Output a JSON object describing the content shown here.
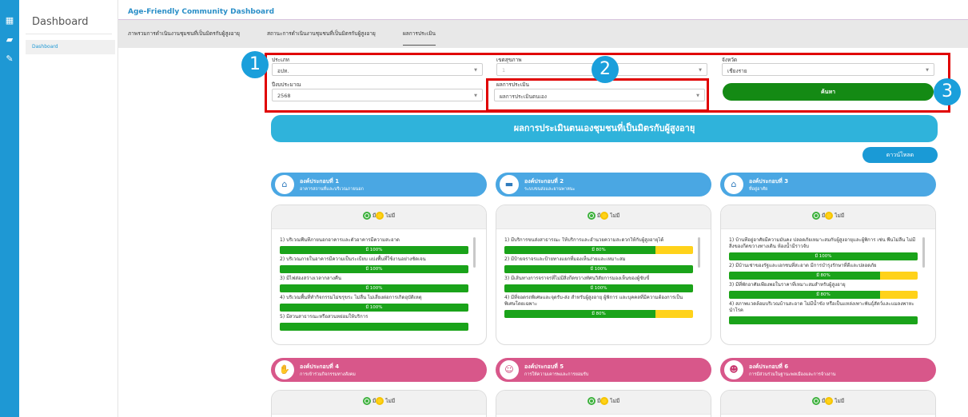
{
  "rail": {
    "icons": [
      "dashboard-icon",
      "folder-icon",
      "edit-icon"
    ]
  },
  "sidebar": {
    "title": "Dashboard",
    "items": [
      {
        "label": "Dashboard"
      }
    ]
  },
  "header": {
    "app_title": "Age-Friendly Community Dashboard",
    "tabs": [
      {
        "label": "ภาพรวมการดำเนินงานชุมชนที่เป็นมิตรกับผู้สูงอายุ"
      },
      {
        "label": "สถานะการดำเนินงานชุมชนที่เป็นมิตรกับผู้สูงอายุ"
      },
      {
        "label": "ผลการประเมิน"
      }
    ],
    "active_tab": "ผลการประเมิน"
  },
  "filters": {
    "type": {
      "label": "ประเภท",
      "value": "อปท."
    },
    "health_zone": {
      "label": "เขตสุขภาพ",
      "value": "1"
    },
    "province": {
      "label": "จังหวัด",
      "value": "เชียงราย"
    },
    "fiscal_year": {
      "label": "ปีงบประมาณ",
      "value": "2568"
    },
    "result": {
      "label": "ผลการประเมิน",
      "value": "ผลการประเมินตนเอง"
    },
    "search_label": "ค้นหา"
  },
  "callouts": [
    "1",
    "2",
    "3"
  ],
  "banner": {
    "title": "ผลการประเมินตนเองชุมชนที่เป็นมิตรกับผู้สูงอายุ"
  },
  "download_label": "ดาวน์โหลด",
  "legend": {
    "yes": "มี",
    "no": "ไม่มี"
  },
  "colors": {
    "yes": "#1aa31a",
    "no": "#ffd21a",
    "header_blue": "#4aa7e3",
    "header_pink": "#d8578a"
  },
  "components": [
    {
      "title": "องค์ประกอบที่ 1",
      "subtitle": "อาคารสถานที่และบริเวณภายนอก",
      "icon": "building-icon",
      "items": [
        {
          "text": "1) บริเวณพื้นที่ภายนอกอาคารและตัวอาคารมีความสะอาด",
          "label": "มี 100%",
          "percent": 100
        },
        {
          "text": "2) บริเวณภายในอาคารมีความเป็นระเบียบ แบ่งพื้นที่ใช้งานอย่างชัดเจน",
          "label": "มี 100%",
          "percent": 100
        },
        {
          "text": "3) มีไฟส่องสว่างเวลากลางคืน",
          "label": "มี 100%",
          "percent": 100
        },
        {
          "text": "4) บริเวณพื้นที่ทำกิจกรรมไม่ขรุขระ ไม่ลื่น ไม่เสี่ยงต่อการเกิดอุบัติเหตุ",
          "label": "มี 100%",
          "percent": 100
        },
        {
          "text": "5) มีสวนสาธารณะหรือสวนหย่อมให้บริการ",
          "label": "",
          "percent": 100
        }
      ]
    },
    {
      "title": "องค์ประกอบที่ 2",
      "subtitle": "ระบบขนส่งและยานพาหนะ",
      "icon": "bus-icon",
      "items": [
        {
          "text": "1) มีบริการขนส่งสาธารณะ ให้บริการและอำนวยความสะดวกให้กับผู้สูงอายุได้",
          "label": "มี 80%",
          "percent": 80
        },
        {
          "text": "2) มีป้ายจราจรและป้ายทางแยกที่มองเห็นง่ายและเหมาะสม",
          "label": "มี 100%",
          "percent": 100
        },
        {
          "text": "3) มีเส้นทางการจราจรที่ไม่มีสิ่งกีดขวางทัศนวิสัยการมองเห็นของผู้ขับขี่",
          "label": "มี 100%",
          "percent": 100
        },
        {
          "text": "4) มีที่จอดรถพิเศษและจุดรับ-ส่ง สำหรับผู้สูงอายุ ผู้พิการ และบุคคลที่มีความต้องการเป็นพิเศษโดยเฉพาะ",
          "label": "มี 80%",
          "percent": 80
        }
      ]
    },
    {
      "title": "องค์ประกอบที่ 3",
      "subtitle": "ที่อยู่อาศัย",
      "icon": "house-icon",
      "items": [
        {
          "text": "1) บ้านที่อยู่อาศัยมีความมั่นคง ปลอดภัยเหมาะสมกับผู้สูงอายุและผู้พิการ เช่น พื้นไม่ลื่น ไม่มีสิ่งของกีดขวางทางเดิน ห้องน้ำมีราวจับ",
          "label": "มี 100%",
          "percent": 100
        },
        {
          "text": "2) มีบ้านเช่าของรัฐและเอกชนที่สะอาด มีการบำรุงรักษาที่ดีและปลอดภัย",
          "label": "มี 80%",
          "percent": 80
        },
        {
          "text": "3) มีที่พักอาศัยเพียงพอในราคาที่เหมาะสมสำหรับผู้สูงอายุ",
          "label": "มี 80%",
          "percent": 80
        },
        {
          "text": "4) สภาพแวดล้อมบริเวณบ้านสะอาด ไม่มีน้ำขัง หรือเป็นแหล่งเพาะพันธุ์สัตว์และแมลงพาหะนำโรค",
          "label": "",
          "percent": 100
        }
      ]
    },
    {
      "title": "องค์ประกอบที่ 4",
      "subtitle": "การเข้าร่วมกิจกรรมทางสังคม",
      "icon": "handshake-icon",
      "items": []
    },
    {
      "title": "องค์ประกอบที่ 5",
      "subtitle": "การให้ความเคารพและการยอมรับ",
      "icon": "people-icon",
      "items": []
    },
    {
      "title": "องค์ประกอบที่ 6",
      "subtitle": "การมีส่วนร่วมในฐานะพลเมืองและการจ้างงาน",
      "icon": "worker-icon",
      "items": []
    }
  ]
}
